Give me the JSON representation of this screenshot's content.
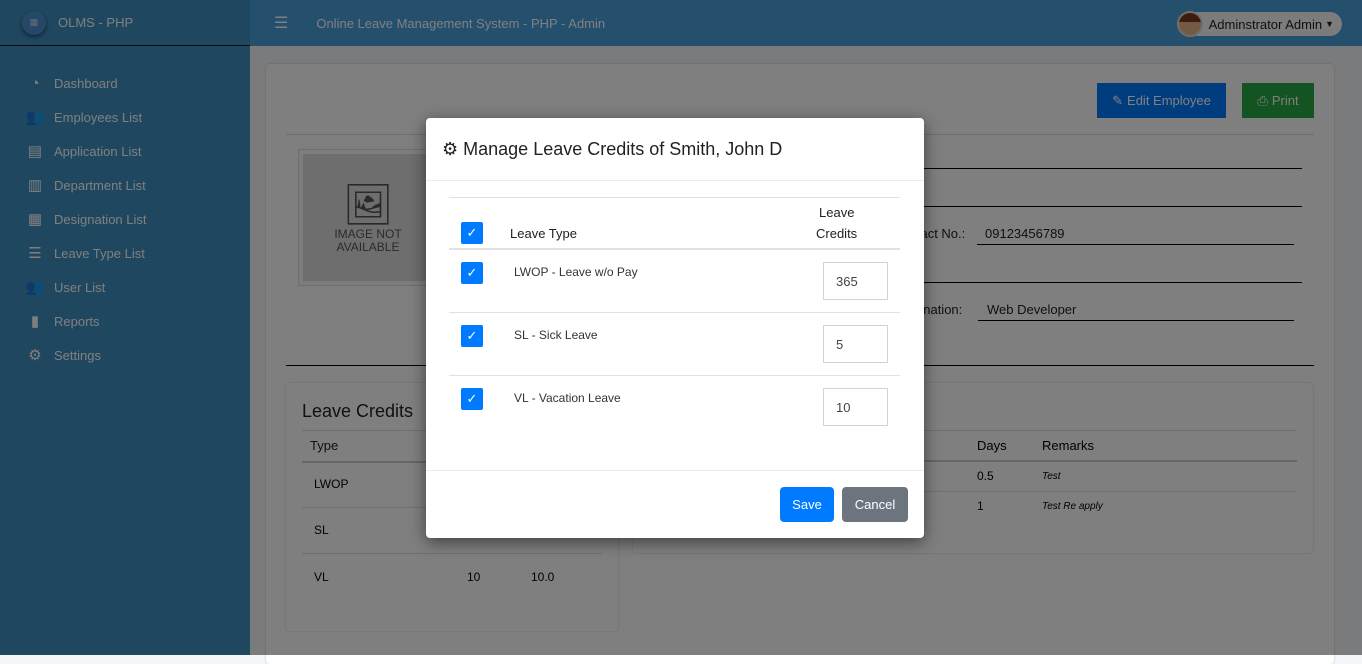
{
  "app": {
    "brand": "OLMS - PHP",
    "title": "Online Leave Management System - PHP - Admin",
    "user": "Adminstrator Admin"
  },
  "sidebar": {
    "items": [
      {
        "label": "Dashboard",
        "icon": "tachometer-icon"
      },
      {
        "label": "Employees List",
        "icon": "users-icon"
      },
      {
        "label": "Application List",
        "icon": "file-icon"
      },
      {
        "label": "Department List",
        "icon": "building-icon"
      },
      {
        "label": "Designation List",
        "icon": "th-list-icon"
      },
      {
        "label": "Leave Type List",
        "icon": "list-icon"
      },
      {
        "label": "User List",
        "icon": "users-icon"
      },
      {
        "label": "Reports",
        "icon": "file-icon"
      },
      {
        "label": "Settings",
        "icon": "cogs-icon"
      }
    ]
  },
  "employee": {
    "edit_label": "Edit Employee",
    "print_label": "Print",
    "image_text_1": "IMAGE NOT",
    "image_text_2": "AVAILABLE",
    "contact_label": "Contact No.:",
    "contact": "09123456789",
    "designation_label": "Designation:",
    "designation": "Web Developer"
  },
  "leave_credits": {
    "title": "Leave Credits",
    "header": [
      "Type"
    ],
    "rows": [
      {
        "type": "LWOP",
        "a": "",
        "b": ""
      },
      {
        "type": "SL",
        "a": "",
        "b": ""
      },
      {
        "type": "VL",
        "a": "10",
        "b": "10.0"
      }
    ]
  },
  "applications": {
    "header": [
      "Days",
      "Remarks"
    ],
    "rows": [
      {
        "days": "0.5",
        "remarks": "Test"
      },
      {
        "days": "1",
        "remarks": "Test Re apply"
      }
    ]
  },
  "modal": {
    "title": "Manage Leave Credits of Smith, John D",
    "col_type": "Leave Type",
    "col_credits_1": "Leave",
    "col_credits_2": "Credits",
    "rows": [
      {
        "type": "LWOP - Leave w/o Pay",
        "credits": "365",
        "checked": true
      },
      {
        "type": "SL - Sick Leave",
        "credits": "5",
        "checked": true
      },
      {
        "type": "VL - Vacation Leave",
        "credits": "10",
        "checked": true
      }
    ],
    "save": "Save",
    "cancel": "Cancel"
  },
  "colors": {
    "primary": "#007bff",
    "success": "#28a745",
    "secondary": "#6c757d"
  }
}
